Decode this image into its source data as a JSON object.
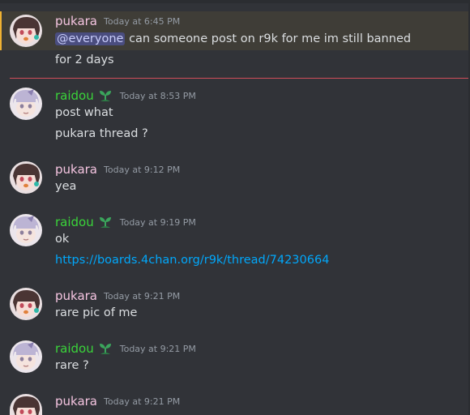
{
  "messages": [
    {
      "user": "pukara",
      "time": "Today at 6:45 PM",
      "mention": "@everyone",
      "lines": [
        "can someone post on r9k for me im still banned",
        "for 2 days"
      ]
    },
    {
      "user": "raidou",
      "time": "Today at 8:53 PM",
      "lines": [
        "post what",
        "pukara thread ?"
      ]
    },
    {
      "user": "pukara",
      "time": "Today at 9:12 PM",
      "lines": [
        "yea"
      ]
    },
    {
      "user": "raidou",
      "time": "Today at 9:19 PM",
      "lines": [
        "ok",
        "https://boards.4chan.org/r9k/thread/74230664"
      ]
    },
    {
      "user": "pukara",
      "time": "Today at 9:21 PM",
      "lines": [
        "rare pic of me"
      ]
    },
    {
      "user": "raidou",
      "time": "Today at 9:21 PM",
      "lines": [
        "rare ?"
      ]
    },
    {
      "user": "pukara",
      "time": "Today at 9:21 PM",
      "lines": []
    }
  ],
  "colors": {
    "background": "#313338",
    "pukara_name": "#f4c4e0",
    "raidou_name": "#3ad43a",
    "link": "#00a8fc",
    "mention_bg": "#4a4d7f",
    "new_divider": "#d24d5a"
  },
  "icons": {
    "raidou_badge": "sprout-icon"
  }
}
